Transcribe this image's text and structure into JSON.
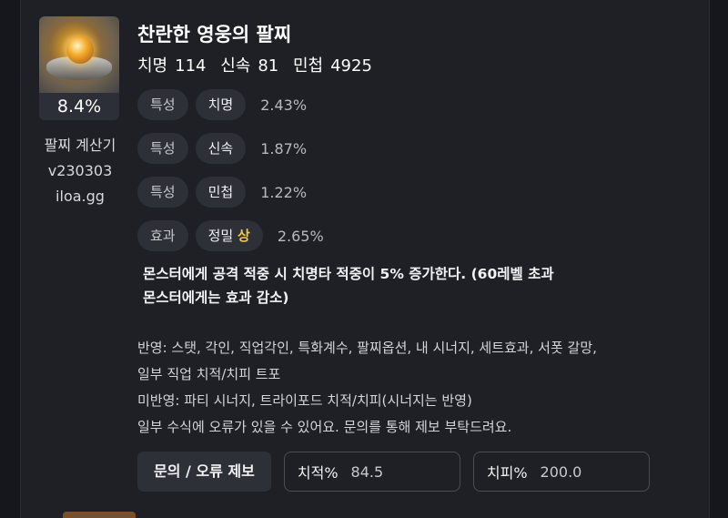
{
  "item": {
    "name": "찬란한 영웅의 팔찌",
    "stats": [
      {
        "label": "치명",
        "value": "114"
      },
      {
        "label": "신속",
        "value": "81"
      },
      {
        "label": "민첩",
        "value": "4925"
      }
    ],
    "percent_badge": "8.4%",
    "icon": "bracelet-icon"
  },
  "calculator": {
    "title": "팔찌 계산기",
    "version": "v230303",
    "site": "iloa.gg"
  },
  "rows": [
    {
      "type": "특성",
      "stat": "치명",
      "grade": "",
      "value": "2.43%"
    },
    {
      "type": "특성",
      "stat": "신속",
      "grade": "",
      "value": "1.87%"
    },
    {
      "type": "특성",
      "stat": "민첩",
      "grade": "",
      "value": "1.22%"
    },
    {
      "type": "효과",
      "stat": "정밀",
      "grade": "상",
      "value": "2.65%"
    }
  ],
  "effect_text_line1": "몬스터에게 공격 적중 시 치명타 적중이 5% 증가한다. (60레벨 초과",
  "effect_text_line2": "몬스터에게는 효과 감소)",
  "notes": {
    "line1": "반영: 스탯, 각인, 직업각인, 특화계수, 팔찌옵션, 내 시너지, 세트효과, 서폿 갈망,",
    "line2": "일부 직업 치적/치피 트포",
    "line3": "미반영: 파티 시너지, 트라이포드 치적/치피(시너지는 반영)",
    "line4": "일부 수식에 오류가 있을 수 있어요. 문의를 통해 제보 부탁드려요."
  },
  "controls": {
    "report_button": "문의 / 오류 제보",
    "crit_rate_label": "치적%",
    "crit_rate_value": "84.5",
    "crit_dmg_label": "치피%",
    "crit_dmg_value": "200.0"
  },
  "colors": {
    "background": "#1e2026",
    "pill": "#2d3037",
    "grade_accent": "#f0c94a"
  }
}
